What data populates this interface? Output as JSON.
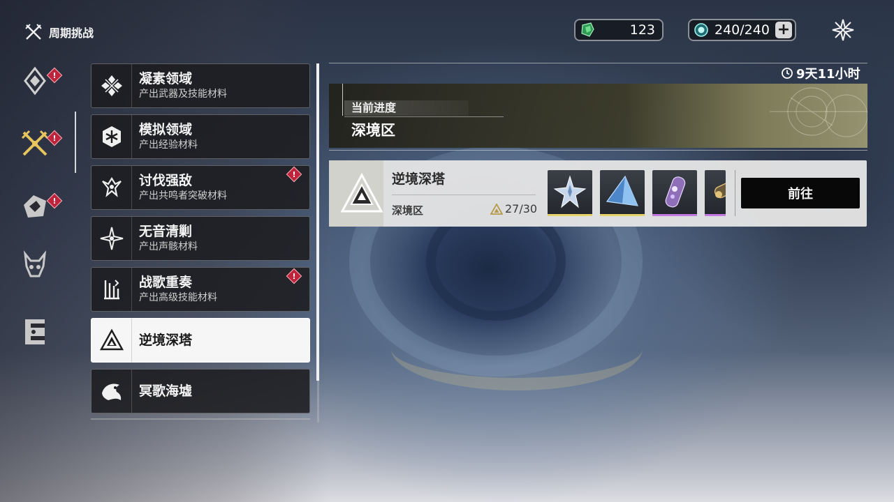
{
  "header": {
    "title": "周期挑战",
    "title_icon": "crossed-swords-icon"
  },
  "currencies": [
    {
      "icon": "green-crystal-icon",
      "value": "123"
    },
    {
      "icon": "stamina-orb-icon",
      "value": "240/240",
      "add_label": "+"
    }
  ],
  "close_icon": "close-star-icon",
  "side_nav": [
    {
      "icon": "diamond-emblem-icon",
      "alert": true
    },
    {
      "icon": "crossed-swords-icon",
      "alert": true,
      "selected": true
    },
    {
      "icon": "monster-emblem-icon",
      "alert": true
    },
    {
      "icon": "demon-head-icon",
      "alert": false
    },
    {
      "icon": "gate-icon",
      "alert": false
    }
  ],
  "alert_mark": "!",
  "categories": [
    {
      "name": "凝素领域",
      "desc": "产出武器及技能材料",
      "icon": "crystal-cross-icon",
      "alert": false
    },
    {
      "name": "模拟领域",
      "desc": "产出经验材料",
      "icon": "hex-circuit-icon",
      "alert": false
    },
    {
      "name": "讨伐强敌",
      "desc": "产出共鸣者突破材料",
      "icon": "beast-claw-icon",
      "alert": true
    },
    {
      "name": "无音清剿",
      "desc": "产出声骸材料",
      "icon": "sparkle-star-icon",
      "alert": false
    },
    {
      "name": "战歌重奏",
      "desc": "产出高级技能材料",
      "icon": "harp-icon",
      "alert": true
    },
    {
      "name": "逆境深塔",
      "desc": "",
      "icon": "triangle-tower-icon",
      "alert": false,
      "active": true
    },
    {
      "name": "冥歌海墟",
      "desc": "",
      "icon": "sea-beast-icon",
      "alert": false
    }
  ],
  "timer": {
    "icon": "clock-icon",
    "text": "9天11小时"
  },
  "progress": {
    "label": "当前进度",
    "value": "深境区"
  },
  "challenge": {
    "title": "逆境深塔",
    "area": "深境区",
    "score": "27/30",
    "score_icon": "triangle-badge-icon",
    "icon": "triangle-tower-icon",
    "go_label": "前往",
    "rewards": [
      {
        "icon": "star-crystal-icon",
        "rarity_color": "#e8d26a"
      },
      {
        "icon": "blue-pyramid-icon",
        "rarity_color": "#e8d26a"
      },
      {
        "icon": "purple-capsule-icon",
        "rarity_color": "#c37ae0"
      },
      {
        "icon": "gold-tube-icon",
        "rarity_color": "#c37ae0"
      }
    ]
  }
}
